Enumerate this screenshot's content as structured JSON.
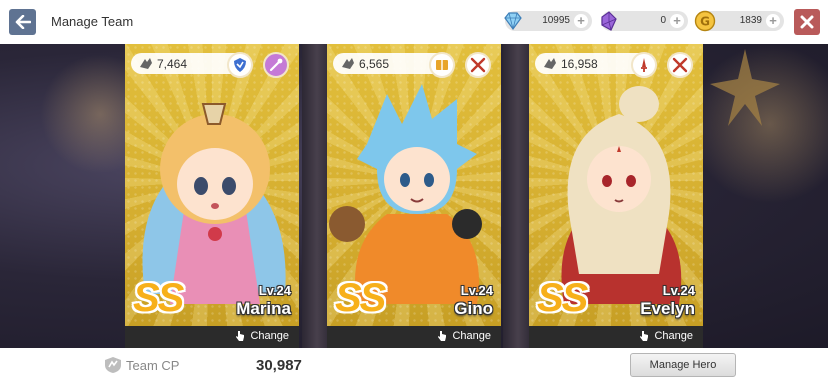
{
  "header": {
    "title": "Manage Team",
    "currencies": [
      {
        "icon": "diamond-icon",
        "value": "10995"
      },
      {
        "icon": "purple-gem-icon",
        "value": "0"
      },
      {
        "icon": "gold-coin-icon",
        "value": "1839"
      }
    ]
  },
  "heroes": [
    {
      "cp": "7,464",
      "badges": [
        "shield-class-icon",
        "magic-wand-icon"
      ],
      "grade": "SS",
      "level": "Lv.24",
      "name": "Marina",
      "change_label": "Change"
    },
    {
      "cp": "6,565",
      "badges": [
        "book-class-icon",
        "crossed-swords-icon"
      ],
      "grade": "SS",
      "level": "Lv.24",
      "name": "Gino",
      "change_label": "Change"
    },
    {
      "cp": "16,958",
      "badges": [
        "sword-class-icon",
        "crossed-swords-icon"
      ],
      "grade": "SS",
      "level": "Lv.24",
      "name": "Evelyn",
      "change_label": "Change"
    }
  ],
  "footer": {
    "team_cp_label": "Team CP",
    "team_cp_value": "30,987",
    "manage_hero_label": "Manage Hero"
  },
  "colors": {
    "back_button": "#5f7392",
    "close_button": "#b95a5a",
    "card_gold": "#d9b637",
    "grade_orange": "#f7b01a"
  }
}
